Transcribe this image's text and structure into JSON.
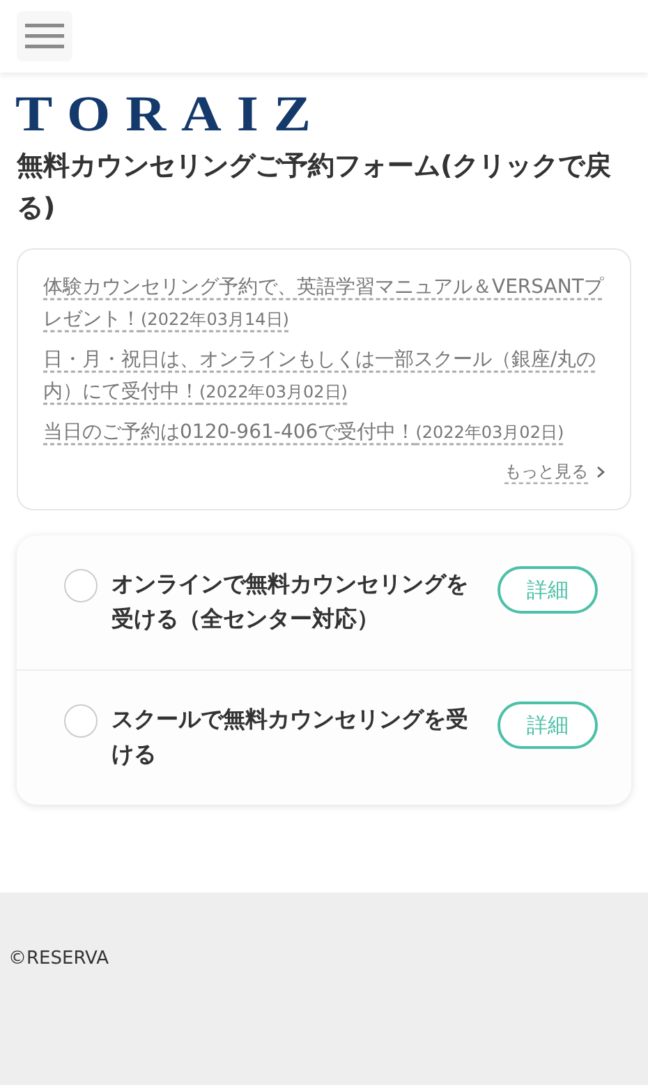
{
  "logo": "TORAIZ",
  "page_title": "無料カウンセリングご予約フォーム(クリックで戻る)",
  "news": [
    {
      "text": "体験カウンセリング予約で、英語学習マニュアル＆VERSANTプレゼント！",
      "date": "(2022年03月14日)"
    },
    {
      "text": "日・月・祝日は、オンラインもしくは一部スクール（銀座/丸の内）にて受付中！",
      "date": "(2022年03月02日)"
    },
    {
      "text": "当日のご予約は0120-961-406で受付中！",
      "date": "(2022年03月02日)"
    }
  ],
  "more_link": "もっと見る",
  "options": [
    {
      "label": "オンラインで無料カウンセリングを受ける（全センター対応）",
      "selected": false,
      "button": "詳細"
    },
    {
      "label": "スクールで無料カウンセリングを受ける",
      "selected": false,
      "button": "詳細"
    }
  ],
  "footer": "©RESERVA"
}
